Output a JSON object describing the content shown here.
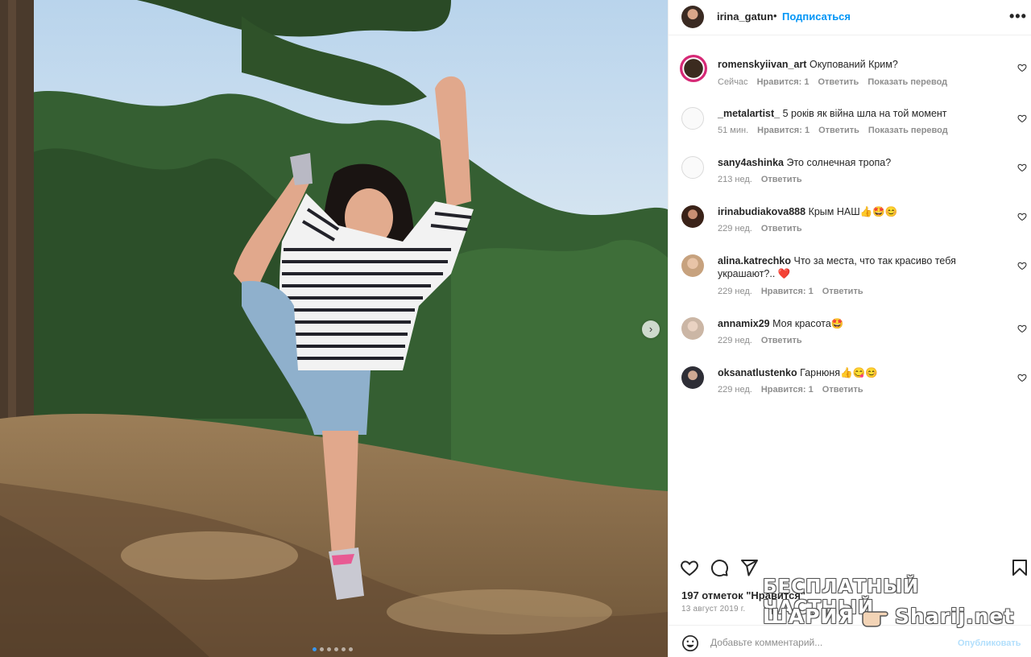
{
  "post": {
    "username": "irina_gatun",
    "separator": "•",
    "follow_label": "Подписаться",
    "more_label": "•••",
    "likes_text": "197 отметок \"Нравится\"",
    "date_text": "13 август 2019 г.",
    "carousel_count": 6,
    "carousel_active": 1
  },
  "comments": [
    {
      "user": "romenskyiivan_art",
      "text": "Окупований Крим?",
      "time": "Сейчас",
      "likes": "Нравится: 1",
      "reply": "Ответить",
      "translate": "Показать перевод",
      "avatar": "ring"
    },
    {
      "user": "_metalartist_",
      "text": "5 років як війна шла на той момент",
      "time": "51 мин.",
      "likes": "Нравится: 1",
      "reply": "Ответить",
      "translate": "Показать перевод",
      "avatar": "grey"
    },
    {
      "user": "sany4ashinka",
      "text": "Это солнечная тропа?",
      "time": "213 нед.",
      "reply": "Ответить",
      "avatar": "grey"
    },
    {
      "user": "irinabudiakova888",
      "text": "Крым НАШ👍🤩😊",
      "time": "229 нед.",
      "reply": "Ответить",
      "avatar": "photo"
    },
    {
      "user": "alina.katrechko",
      "text": "Что за места, что так красиво тебя украшают?.. ❤️",
      "time": "229 нед.",
      "likes": "Нравится: 1",
      "reply": "Ответить",
      "avatar": "photo"
    },
    {
      "user": "annamix29",
      "text": "Моя красота🤩",
      "time": "229 нед.",
      "reply": "Ответить",
      "avatar": "photo"
    },
    {
      "user": "oksanatlustenko",
      "text": "Гарнюня👍😋😊",
      "time": "229 нед.",
      "likes": "Нравится: 1",
      "reply": "Ответить",
      "avatar": "photo"
    }
  ],
  "add_comment": {
    "placeholder": "Добавьте комментарий...",
    "publish_label": "Опубликовать"
  },
  "watermark": {
    "line1": "БЕСПЛАТНЫЙ ЧАСТНЫЙ",
    "line2": "ШАРИЯ",
    "line3": "Sharij.net"
  },
  "icons": [
    "heart-icon",
    "comment-icon",
    "share-icon",
    "bookmark-icon",
    "emoji-icon",
    "chevron-right-icon",
    "more-icon"
  ],
  "colors": {
    "accent": "#0095f6",
    "text": "#262626",
    "muted": "#8e8e8e",
    "publish_disabled": "#b2dffc",
    "carousel_active": "#3897f0"
  }
}
